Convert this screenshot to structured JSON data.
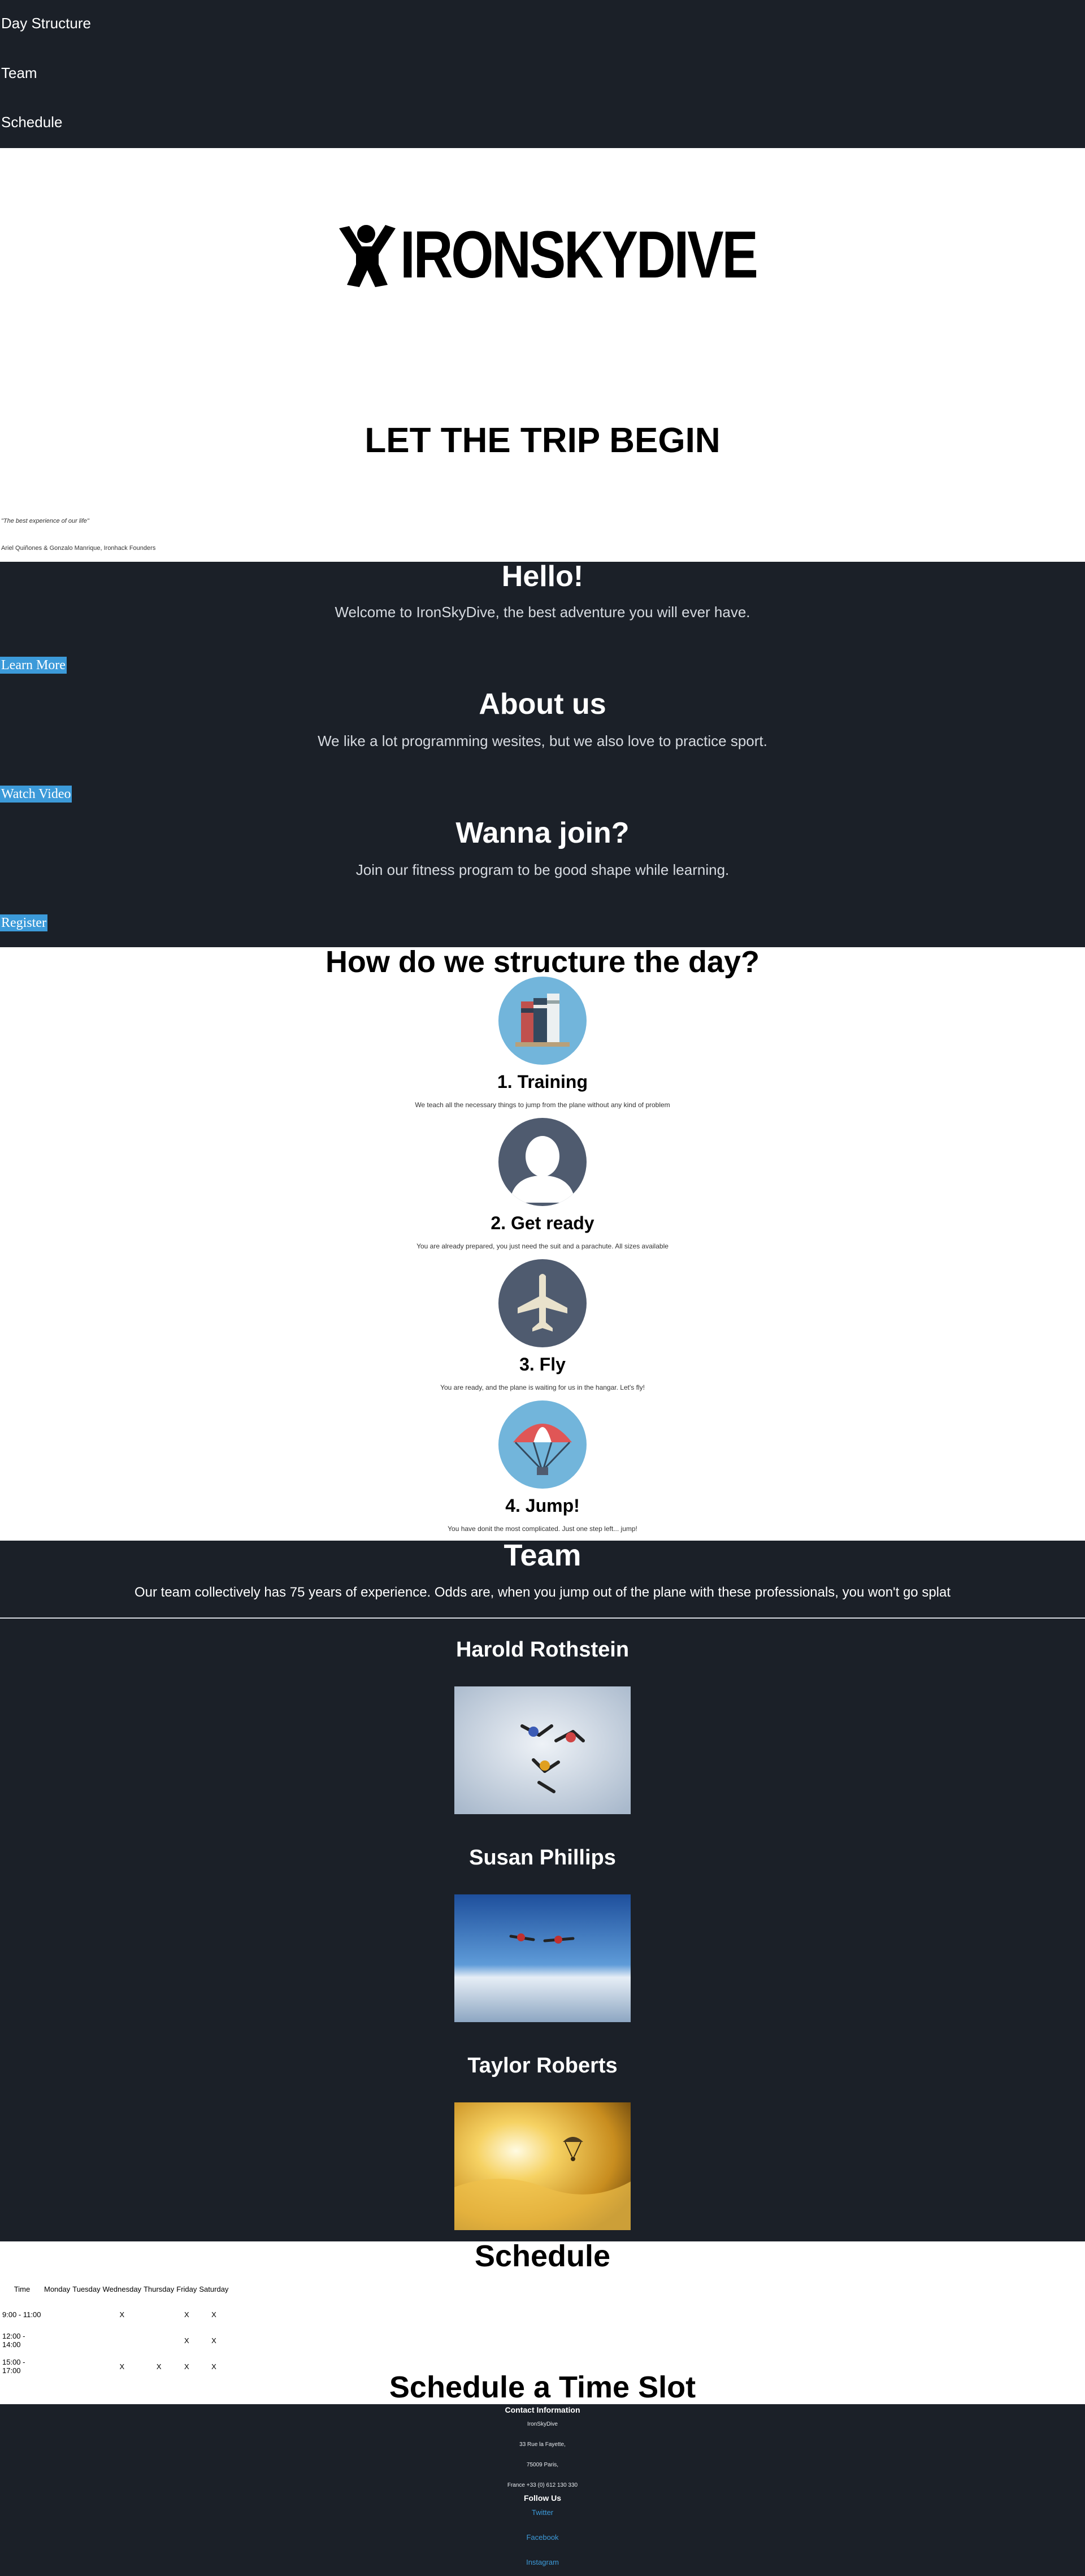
{
  "nav": {
    "items": [
      {
        "label": "Day Structure"
      },
      {
        "label": "Team"
      },
      {
        "label": "Schedule"
      }
    ]
  },
  "hero": {
    "logo_text": "IRONSKYDIVE",
    "title": "LET THE TRIP BEGIN",
    "quote": "\"The best experience of our life\"",
    "authors": "Ariel Quiñones & Gonzalo Manrique, Ironhack Founders"
  },
  "cta": [
    {
      "title": "Hello!",
      "subtitle": "Welcome to IronSkyDive, the best adventure you will ever have.",
      "button": "Learn More"
    },
    {
      "title": "About us",
      "subtitle": "We like a lot programming wesites, but we also love to practice sport.",
      "button": "Watch Video"
    },
    {
      "title": "Wanna join?",
      "subtitle": "Join our fitness program to be good shape while learning.",
      "button": "Register"
    }
  ],
  "structure": {
    "title": "How do we structure the day?",
    "steps": [
      {
        "title": "1. Training",
        "desc": "We teach all the necessary things to jump from the plane without any kind of problem",
        "icon": "books-icon"
      },
      {
        "title": "2. Get ready",
        "desc": "You are already prepared, you just need the suit and a parachute. All sizes available",
        "icon": "person-icon"
      },
      {
        "title": "3. Fly",
        "desc": "You are ready, and the plane is waiting for us in the hangar. Let's fly!",
        "icon": "airplane-icon"
      },
      {
        "title": "4. Jump!",
        "desc": "You have donit the most complicated. Just one step left... jump!",
        "icon": "parachute-icon"
      }
    ]
  },
  "team": {
    "title": "Team",
    "subtitle": "Our team collectively has 75 years of experience. Odds are, when you jump out of the plane with these professionals, you won't go splat",
    "members": [
      {
        "name": "Harold Rothstein"
      },
      {
        "name": "Susan Phillips"
      },
      {
        "name": "Taylor Roberts"
      }
    ]
  },
  "schedule": {
    "title": "Schedule",
    "headers": [
      "Time",
      "Monday",
      "Tuesday",
      "Wednesday",
      "Thursday",
      "Friday",
      "Saturday"
    ],
    "rows": [
      [
        "9:00 - 11:00",
        "",
        "",
        "X",
        "",
        "X",
        "X"
      ],
      [
        "12:00 - 14:00",
        "",
        "",
        "",
        "",
        "X",
        "X"
      ],
      [
        "15:00 - 17:00",
        "",
        "",
        "X",
        "X",
        "X",
        "X"
      ]
    ],
    "slot_title": "Schedule a Time Slot"
  },
  "footer": {
    "contact_title": "Contact Information",
    "lines": [
      "IronSkyDive",
      "33 Rue la Fayette,",
      "75009 Paris,",
      "France +33 (0) 612 130 330"
    ],
    "follow_title": "Follow Us",
    "links": [
      "Twitter",
      "Facebook",
      "Instagram"
    ]
  },
  "colors": {
    "dark_bg": "#1b2028",
    "accent": "#3c9ad9"
  }
}
